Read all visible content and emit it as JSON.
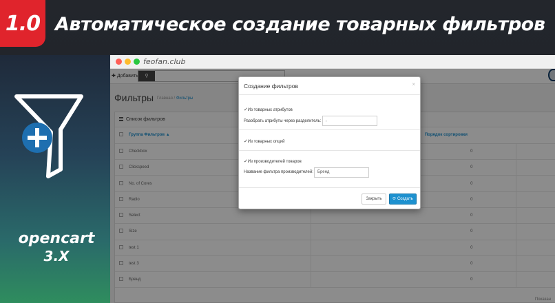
{
  "banner": {
    "version": "1.0",
    "headline": "Автоматическое создание товарных фильтров",
    "platform": "opencart",
    "platform_version": "3.X"
  },
  "browser": {
    "url": "feofan.club"
  },
  "admin": {
    "add_label": "Добавить",
    "page_title": "Фильтры",
    "crumb_home": "Главная",
    "crumb_sep": "/",
    "crumb_current": "Фильтры",
    "panel_title": "Список фильтров",
    "columns": [
      "Группа Фильтров ▲",
      "Порядок сортировки"
    ],
    "rows": [
      {
        "name": "Checkbox",
        "order": "0"
      },
      {
        "name": "Clickspeed",
        "order": "0"
      },
      {
        "name": "No. of Cores",
        "order": "0"
      },
      {
        "name": "Radio",
        "order": "0"
      },
      {
        "name": "Select",
        "order": "0"
      },
      {
        "name": "Size",
        "order": "0"
      },
      {
        "name": "test 1",
        "order": "0"
      },
      {
        "name": "test 3",
        "order": "0"
      },
      {
        "name": "Бренд",
        "order": "0"
      }
    ],
    "footer": "Показан"
  },
  "modal": {
    "title": "Создание фильтров",
    "close_x": "×",
    "check_attributes": "Из товарных атрибутов",
    "separator_label": "Разобрать атрибуты через разделитель:",
    "separator_value": ",",
    "check_options": "Из товарных опций",
    "check_manufacturers": "Из производителей товаров",
    "manufacturer_label": "Название фильтра производителей:",
    "manufacturer_value": "Бренд",
    "btn_close": "Закрыть",
    "btn_create": "Создать"
  },
  "colors": {
    "accent_red": "#e0242c",
    "link_blue": "#1e91cf"
  }
}
